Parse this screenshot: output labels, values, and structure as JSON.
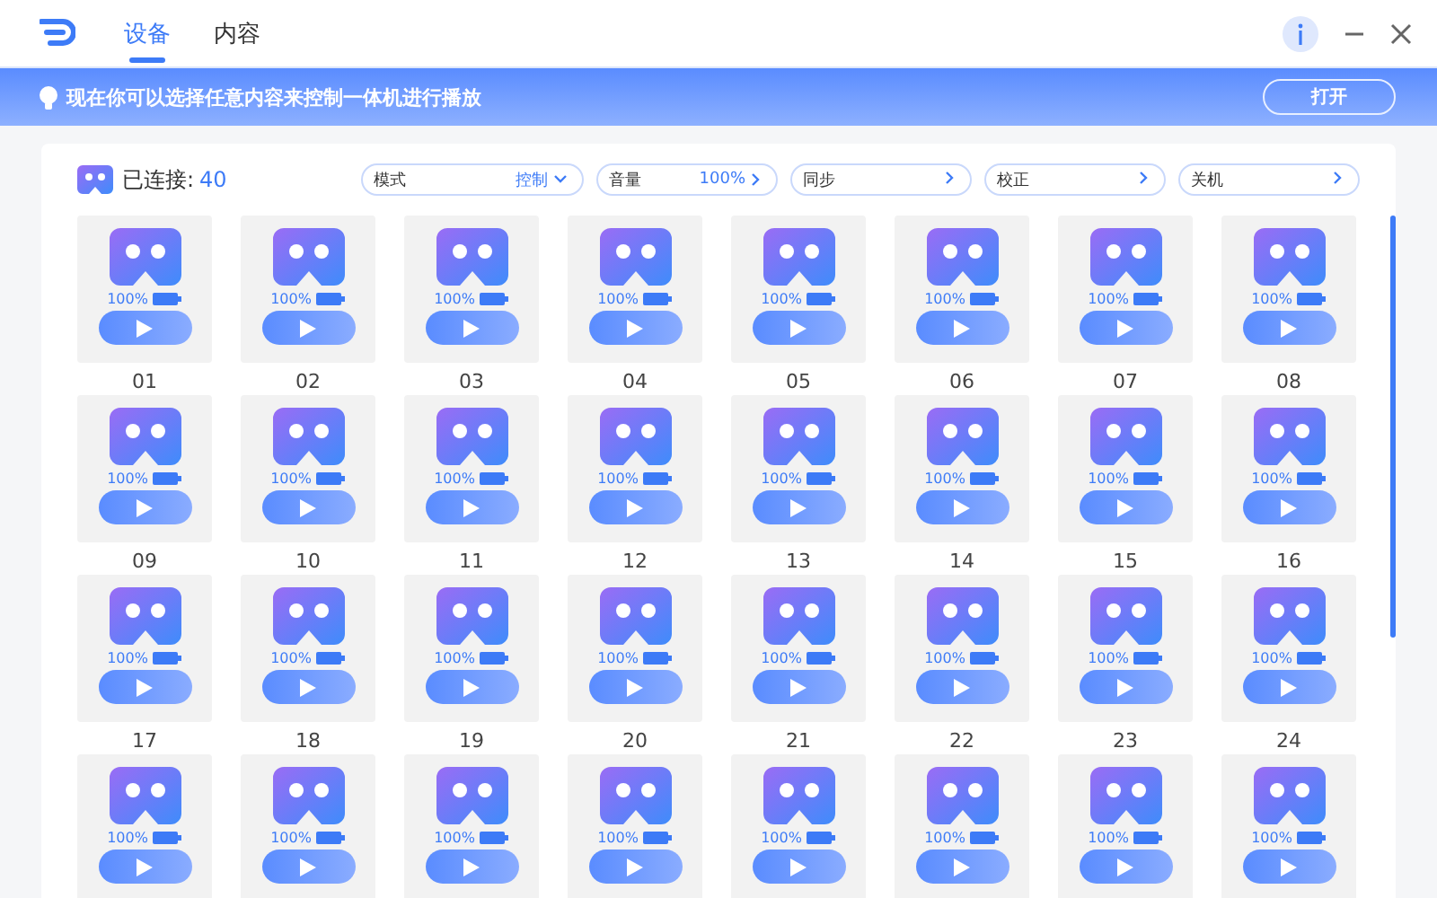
{
  "tabs": [
    {
      "label": "设备",
      "selected": true
    },
    {
      "label": "内容",
      "selected": false
    }
  ],
  "banner": {
    "message": "现在你可以选择任意内容来控制一体机进行播放",
    "button": "打开"
  },
  "toolbar": {
    "connected_label": "已连接:",
    "connected_count": "40",
    "controls": [
      {
        "kind": "dropdown",
        "label": "模式",
        "value": "控制"
      },
      {
        "kind": "link",
        "label": "音量",
        "value": "100%"
      },
      {
        "kind": "link",
        "label": "同步"
      },
      {
        "kind": "link",
        "label": "校正"
      },
      {
        "kind": "link",
        "label": "关机"
      }
    ]
  },
  "devices": [
    {
      "battery": "100%",
      "label": "01"
    },
    {
      "battery": "100%",
      "label": "02"
    },
    {
      "battery": "100%",
      "label": "03"
    },
    {
      "battery": "100%",
      "label": "04"
    },
    {
      "battery": "100%",
      "label": "05"
    },
    {
      "battery": "100%",
      "label": "06"
    },
    {
      "battery": "100%",
      "label": "07"
    },
    {
      "battery": "100%",
      "label": "08"
    },
    {
      "battery": "100%",
      "label": "09"
    },
    {
      "battery": "100%",
      "label": "10"
    },
    {
      "battery": "100%",
      "label": "11"
    },
    {
      "battery": "100%",
      "label": "12"
    },
    {
      "battery": "100%",
      "label": "13"
    },
    {
      "battery": "100%",
      "label": "14"
    },
    {
      "battery": "100%",
      "label": "15"
    },
    {
      "battery": "100%",
      "label": "16"
    },
    {
      "battery": "100%",
      "label": "17"
    },
    {
      "battery": "100%",
      "label": "18"
    },
    {
      "battery": "100%",
      "label": "19"
    },
    {
      "battery": "100%",
      "label": "20"
    },
    {
      "battery": "100%",
      "label": "21"
    },
    {
      "battery": "100%",
      "label": "22"
    },
    {
      "battery": "100%",
      "label": "23"
    },
    {
      "battery": "100%",
      "label": "24"
    },
    {
      "battery": "100%"
    },
    {
      "battery": "100%"
    },
    {
      "battery": "100%"
    },
    {
      "battery": "100%"
    },
    {
      "battery": "100%"
    },
    {
      "battery": "100%"
    },
    {
      "battery": "100%"
    },
    {
      "battery": "100%"
    }
  ]
}
